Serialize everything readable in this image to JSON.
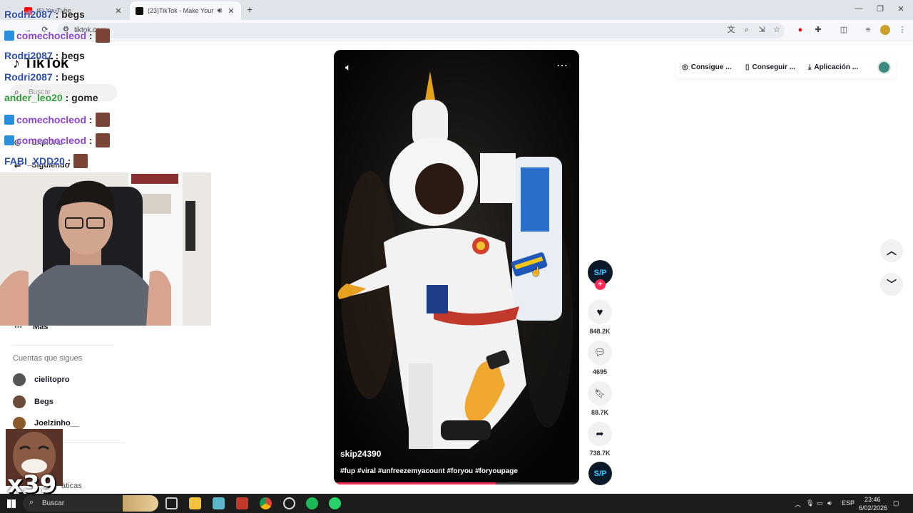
{
  "browser": {
    "tabs": [
      {
        "title": "(6) YouTube",
        "favicon_color": "#ff0000",
        "active": false
      },
      {
        "title": "(23)TikTok - Make Your Day",
        "favicon_color": "#111111",
        "active": true
      }
    ],
    "new_tab": "+",
    "url": "tiktok.com"
  },
  "tiktok": {
    "logo": "TikTok",
    "search_placeholder": "Buscar",
    "nav": [
      "Explorar",
      "Siguiendo",
      "Más"
    ],
    "following_heading": "Cuentas que sigues",
    "following": [
      {
        "name": "cielitopro",
        "color": "#555"
      },
      {
        "name": "Begs",
        "color": "#6b4b3b"
      },
      {
        "name": "Joelzinho__",
        "color": "#8a5a2b"
      }
    ],
    "more_link": "áticas",
    "top_right": [
      "Consigue ...",
      "Conseguir ...",
      "Aplicación ..."
    ],
    "video": {
      "author": "skip24390",
      "caption": "#fup #viral #unfreezemyacount #foryou #foryoupage",
      "progress": 0.66
    },
    "actions": {
      "avatar_text": "S/P",
      "likes": "848.2K",
      "comments": "4695",
      "saves": "88.7K",
      "shares": "738.7K"
    }
  },
  "overlay": {
    "chat": [
      {
        "user": "Rodri2087",
        "msg": ": begs",
        "style": "n1"
      },
      {
        "user": "comechocleod",
        "msg": ":",
        "style": "n2"
      },
      {
        "user": "Rodri2087",
        "msg": ": begs",
        "style": "n1"
      },
      {
        "user": "Rodri2087",
        "msg": ": begs",
        "style": "n1"
      },
      {
        "user": "ander_leo20",
        "msg": ": gome",
        "style": "n3"
      },
      {
        "user": "comechocleod",
        "msg": ":",
        "style": "n2"
      },
      {
        "user": "comechocleod",
        "msg": ":",
        "style": "n2"
      },
      {
        "user": "FABI_XDD20",
        "msg": ":",
        "style": "n1"
      }
    ],
    "emote_count": "x39"
  },
  "taskbar": {
    "search": "Buscar",
    "lang": "ESP",
    "time": "23:46",
    "date": "6/02/2026"
  }
}
